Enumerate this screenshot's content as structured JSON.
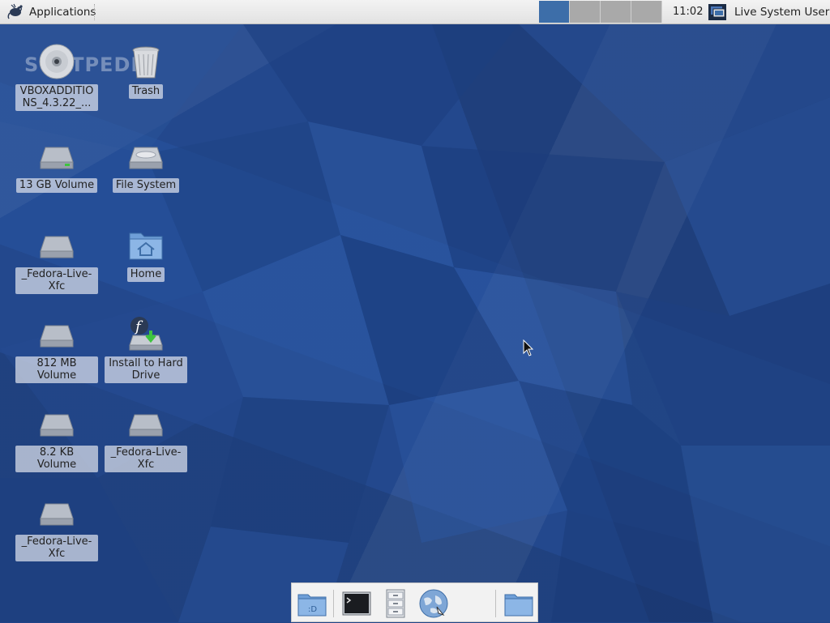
{
  "top_panel": {
    "applications_label": "Applications",
    "clock": "11:02",
    "user_label": "Live System User",
    "workspaces": [
      {
        "name": "workspace-1",
        "active": true
      },
      {
        "name": "workspace-2",
        "active": false
      },
      {
        "name": "workspace-3",
        "active": false
      },
      {
        "name": "workspace-4",
        "active": false
      }
    ]
  },
  "watermark": "SOFTPEDIA",
  "desktop_icons": [
    {
      "label": "VBOXADDITIONS_4.3.22_...",
      "icon": "cdrom-icon"
    },
    {
      "label": "Trash",
      "icon": "trash-icon"
    },
    {
      "label": "13 GB Volume",
      "icon": "drive-icon"
    },
    {
      "label": "File System",
      "icon": "drive-icon"
    },
    {
      "label": "_Fedora-Live-Xfc",
      "icon": "drive-icon"
    },
    {
      "label": "Home",
      "icon": "home-folder-icon"
    },
    {
      "label": "812 MB Volume",
      "icon": "drive-icon"
    },
    {
      "label": "Install to Hard Drive",
      "icon": "fedora-install-icon"
    },
    {
      "label": "8.2 KB Volume",
      "icon": "drive-icon"
    },
    {
      "label": "_Fedora-Live-Xfc",
      "icon": "drive-icon"
    },
    {
      "label": "_Fedora-Live-Xfc",
      "icon": "drive-icon"
    }
  ],
  "dock": [
    {
      "name": "show-desktop",
      "icon": "desktop-folder-icon"
    },
    {
      "name": "terminal",
      "icon": "terminal-icon"
    },
    {
      "name": "file-manager",
      "icon": "file-cabinet-icon"
    },
    {
      "name": "web-browser",
      "icon": "globe-icon"
    },
    {
      "name": "folder",
      "icon": "folder-icon"
    }
  ]
}
